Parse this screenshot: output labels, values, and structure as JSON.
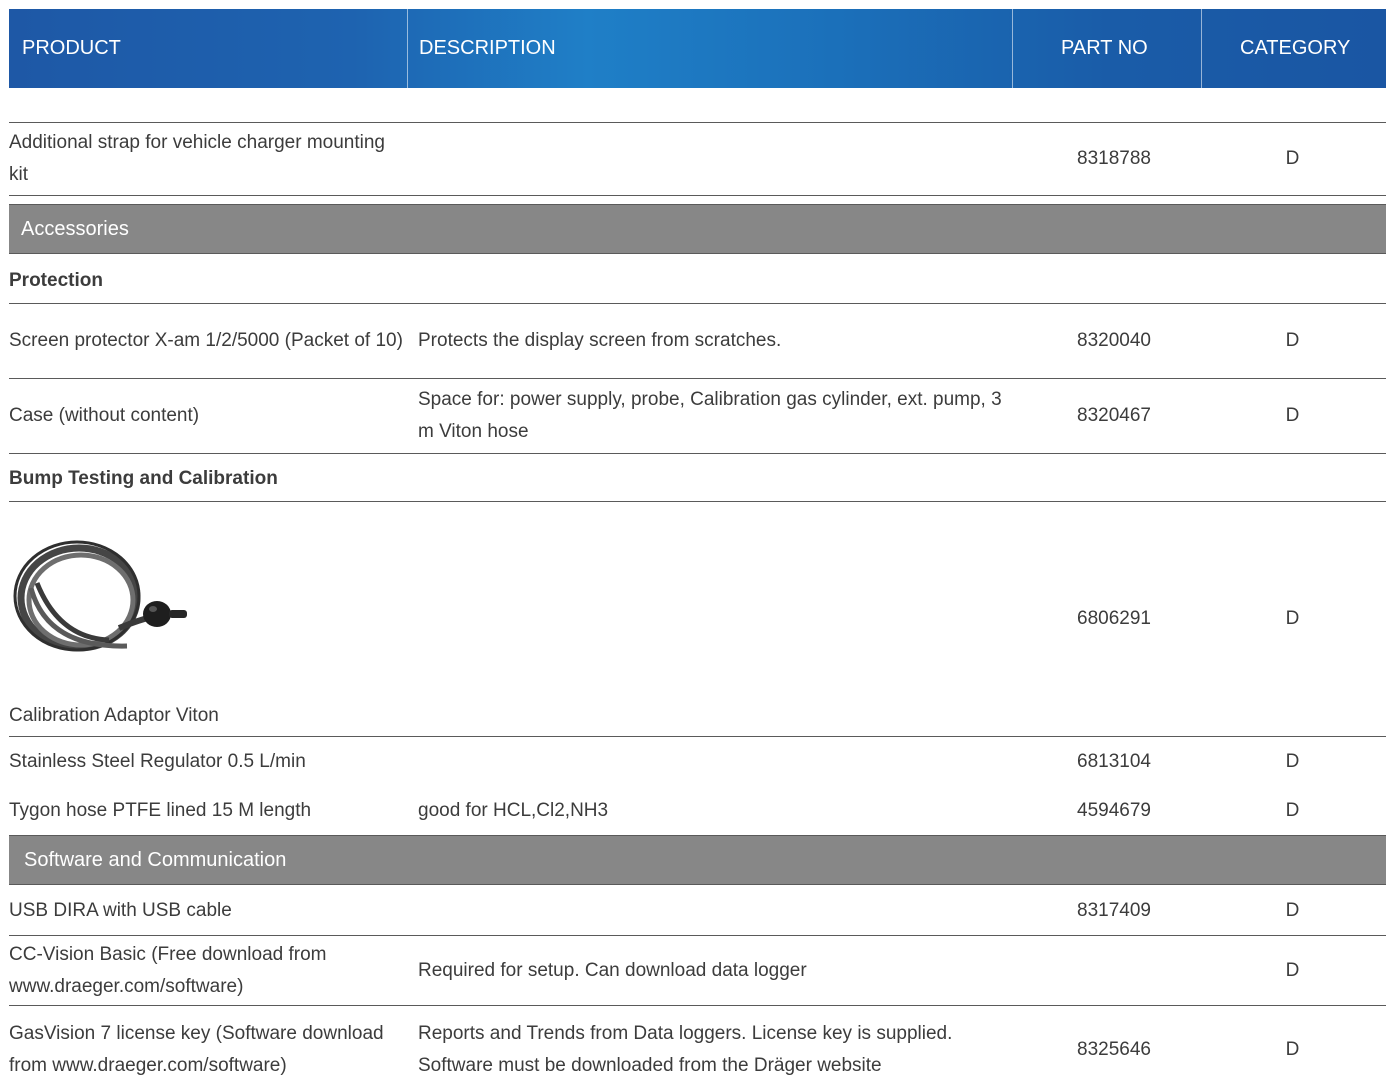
{
  "table": {
    "headers": {
      "product": "PRODUCT",
      "description": "DESCRIPTION",
      "part_no": "PART NO",
      "category": "CATEGORY"
    }
  },
  "rows": {
    "strap": {
      "product": "Additional strap for vehicle charger mounting kit",
      "description": "",
      "part_no": "8318788",
      "category": "D"
    },
    "screen": {
      "product": "Screen protector X-am 1/2/5000 (Packet of 10)",
      "description": "Protects the display screen from scratches.",
      "part_no": "8320040",
      "category": "D"
    },
    "case": {
      "product": "Case (without content)",
      "description": "Space for: power supply, probe, Calibration gas cylinder, ext. pump, 3 m Viton hose",
      "part_no": "8320467",
      "category": "D"
    },
    "adaptor": {
      "product": "Calibration Adaptor Viton",
      "description": "",
      "part_no": "6806291",
      "category": "D"
    },
    "regulator": {
      "product": "Stainless Steel Regulator 0.5 L/min",
      "description": "",
      "part_no": "6813104",
      "category": "D"
    },
    "tygon": {
      "product": "Tygon hose PTFE lined 15 M length",
      "description": "good for HCL,Cl2,NH3",
      "part_no": "4594679",
      "category": "D"
    },
    "usb": {
      "product": "USB DIRA with USB cable",
      "description": "",
      "part_no": "8317409",
      "category": "D"
    },
    "ccvision": {
      "product": "CC-Vision Basic (Free download from www.draeger.com/software)",
      "description": "Required for setup. Can download data logger",
      "part_no": "",
      "category": "D"
    },
    "gasvision": {
      "product": "GasVision 7 license key (Software download from www.draeger.com/software)",
      "description": "Reports and Trends from Data loggers. License key is supplied. Software must be downloaded from the Dräger website",
      "part_no": "8325646",
      "category": "D"
    }
  },
  "sections": {
    "accessories": "Accessories",
    "software": "Software and Communication"
  },
  "subheads": {
    "protection": "Protection",
    "bump": "Bump Testing and Calibration"
  },
  "images": {
    "adaptor_icon": "hose-coil-icon"
  }
}
